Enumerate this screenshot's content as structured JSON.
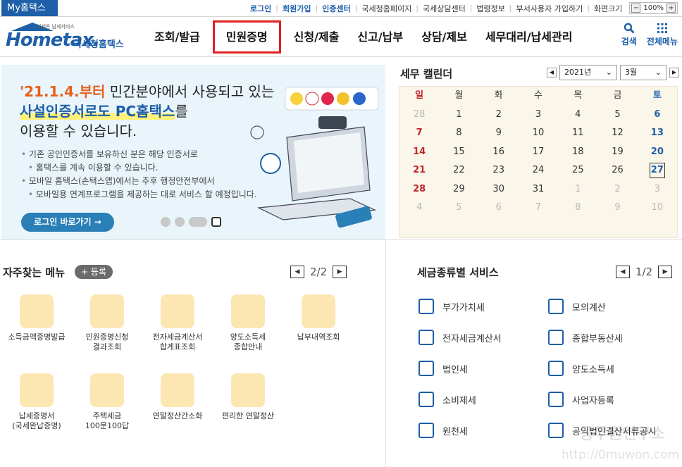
{
  "topbar": {
    "my_tab": "My홈택스",
    "links": [
      "로그인",
      "회원가입",
      "인증센터",
      "국세청홈페이지",
      "국세상담센터",
      "법령정보",
      "부서사용자 가입하기",
      "화면크기"
    ],
    "zoom_minus": "−",
    "zoom_value": "100%",
    "zoom_plus": "+"
  },
  "header": {
    "logo_tagline": "언제든 납세서비스",
    "logo_brand": "Hometax.",
    "logo_name": "국세청홈택스",
    "menu": [
      "조회/발급",
      "민원증명",
      "신청/제출",
      "신고/납부",
      "상담/제보",
      "세무대리/납세관리"
    ],
    "search_label": "검색",
    "all_menu_label": "전체메뉴"
  },
  "banner": {
    "line1_highlight": "'21.1.4.부터",
    "line1_rest": " 민간분야에서 사용되고 있는",
    "line2_highlight": "사설인증서로도 PC홈택스",
    "line2_rest": "를",
    "line3": "이용할 수 있습니다.",
    "bullets": [
      "기존 공인인증서를 보유하신 분은 해당 인증서로",
      "홈택스를 계속 이용할 수 있습니다.",
      "모바일 홈택스(손택스앱)에서는 추후 행정안전부에서",
      "모바일용 연계프로그램을 제공하는 대로 서비스 할 예정입니다."
    ],
    "login_button": "로그인 바로가기 →"
  },
  "calendar": {
    "title": "세무 캘린더",
    "year": "2021년",
    "month": "3월",
    "weekdays": [
      "일",
      "월",
      "화",
      "수",
      "목",
      "금",
      "토"
    ],
    "days": [
      "28",
      "1",
      "2",
      "3",
      "4",
      "5",
      "6",
      "7",
      "8",
      "9",
      "10",
      "11",
      "12",
      "13",
      "14",
      "15",
      "16",
      "17",
      "18",
      "19",
      "20",
      "21",
      "22",
      "23",
      "24",
      "25",
      "26",
      "27",
      "28",
      "29",
      "30",
      "31",
      "1",
      "2",
      "3",
      "4",
      "5",
      "6",
      "7",
      "8",
      "9",
      "10"
    ],
    "muted_indices": [
      0,
      32,
      33,
      34,
      35,
      36,
      37,
      38,
      39,
      40,
      41
    ],
    "today_index": 27
  },
  "favorites": {
    "title": "자주찾는 메뉴",
    "register_label": "+ 등록",
    "page": "2/2",
    "items": [
      "소득금액증명발급",
      "민원증명신청\n결과조회",
      "전자세금계산서\n합계표조회",
      "양도소득세\n종합안내",
      "납부내역조회",
      "납세증명서\n(국세완납증명)",
      "주택세금\n100문100답",
      "연말정산간소화",
      "편리한 연말정산"
    ]
  },
  "tax_services": {
    "title": "세금종류별 서비스",
    "page": "1/2",
    "items": [
      "부가가치세",
      "모의계산",
      "전자세금계산서",
      "종합부동산세",
      "법인세",
      "양도소득세",
      "소비제세",
      "사업자등록",
      "원천세",
      "공익법인결산서류공시"
    ]
  },
  "watermark": {
    "line1": "공무원연구소",
    "line2": "http://0muwon.com"
  },
  "colors": {
    "brand_blue": "#1d5fa8",
    "highlight_red": "#e02020",
    "orange": "#e8601c",
    "banner_bg": "#e9f4fb",
    "calendar_bg": "#fbf6ea"
  }
}
